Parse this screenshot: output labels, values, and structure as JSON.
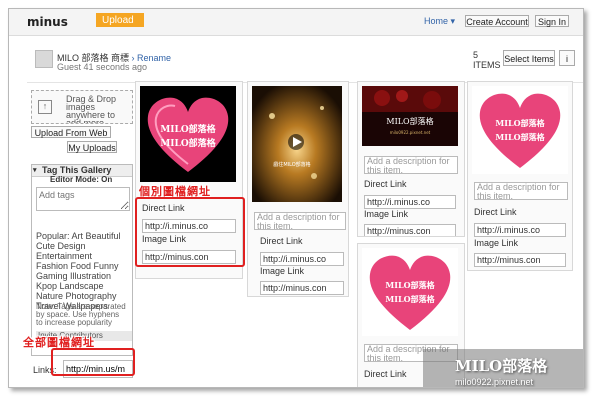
{
  "topbar": {
    "logo": "minus",
    "upload": "Upload",
    "home": "Home",
    "home_caret": "▾",
    "create_account": "Create Account",
    "sign_in": "Sign In"
  },
  "gallery": {
    "title": "MILO 部落格 商標",
    "rename": "Rename",
    "subtitle": "Guest 41 seconds ago",
    "count_num": "5",
    "count_label": "ITEMS",
    "select_items": "Select Items",
    "info": "i"
  },
  "sidebar": {
    "drop_text": "Drag & Drop images anywhere to add more",
    "upload_from_web": "Upload From Web",
    "my_uploads": "My Uploads",
    "tag_title": "Tag This Gallery",
    "editor_mode": "Editor Mode: On",
    "tag_placeholder": "Add tags",
    "popular": "Popular: Art Beautiful Cute Design Entertainment Fashion Food Funny Gaming Illustration Kpop Landscape Nature Photography Travel Wallpapers",
    "note": "Note: Tags are separated by space. Use hyphens to increase popularity",
    "invite": "Invite Contributors",
    "links_label": "Links:",
    "links_value": "http://min.us/m"
  },
  "cards": {
    "desc_placeholder": "Add a description for this item.",
    "direct_label": "Direct Link",
    "image_label": "Image Link",
    "direct_value": "http://i.minus.co",
    "image_value": "http://minus.con"
  },
  "annotations": {
    "single": "個別圖檔網址",
    "all": "全部圖檔網址"
  },
  "thumbs": {
    "heart_text": "MILO部落格",
    "video_caption": "戲住MILO部落格",
    "banner_brand": "MILO部落格",
    "banner_sub": "milo0922.pixnet.net"
  },
  "watermark": {
    "title": "MILO部落格",
    "url": "milo0922.pixnet.net"
  },
  "colors": {
    "upload_orange": "#f5a623",
    "link_blue": "#3264a8",
    "annotation_red": "#e02020",
    "heart_pink": "#e8447a"
  }
}
